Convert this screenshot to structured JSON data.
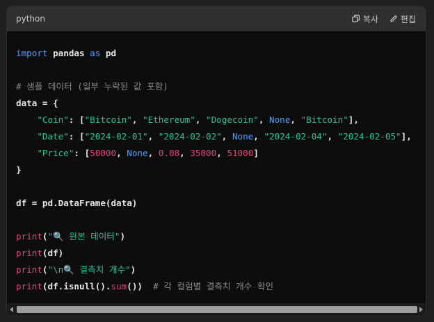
{
  "header": {
    "language": "python",
    "copy_label": "복사",
    "edit_label": "편집"
  },
  "code": {
    "l1": {
      "kw1": "import",
      "t1": " pandas ",
      "kw2": "as",
      "t2": " pd"
    },
    "l3": "# 샘플 데이터 (일부 누락된 값 포함)",
    "l4": "data = {",
    "l5": {
      "indent": "    ",
      "key": "\"Coin\"",
      "sep": ": [",
      "v1": "\"Bitcoin\"",
      "c1": ", ",
      "v2": "\"Ethereum\"",
      "c2": ", ",
      "v3": "\"Dogecoin\"",
      "c3": ", ",
      "v4": "None",
      "c4": ", ",
      "v5": "\"Bitcoin\"",
      "end": "],"
    },
    "l6": {
      "indent": "    ",
      "key": "\"Date\"",
      "sep": ": [",
      "v1": "\"2024-02-01\"",
      "c1": ", ",
      "v2": "\"2024-02-02\"",
      "c2": ", ",
      "v3": "None",
      "c3": ", ",
      "v4": "\"2024-02-04\"",
      "c4": ", ",
      "v5": "\"2024-02-05\"",
      "end": "],"
    },
    "l7": {
      "indent": "    ",
      "key": "\"Price\"",
      "sep": ": [",
      "v1": "50000",
      "c1": ", ",
      "v2": "None",
      "c2": ", ",
      "v3": "0.08",
      "c3": ", ",
      "v4": "35000",
      "c4": ", ",
      "v5": "51000",
      "end": "]"
    },
    "l8": "}",
    "l10": "df = pd.DataFrame(data)",
    "l12": {
      "fn": "print",
      "o": "(",
      "s": "\"🔍 원본 데이터\"",
      "c": ")"
    },
    "l13": {
      "fn": "print",
      "rest": "(df)"
    },
    "l14": {
      "fn": "print",
      "o": "(",
      "s": "\"\\n🔍 결측치 개수\"",
      "c": ")"
    },
    "l15": {
      "fn": "print",
      "a": "(df.isnull().",
      "fn2": "sum",
      "b": "())",
      "cm": "  # 각 컬럼별 결측치 개수 확인"
    }
  }
}
